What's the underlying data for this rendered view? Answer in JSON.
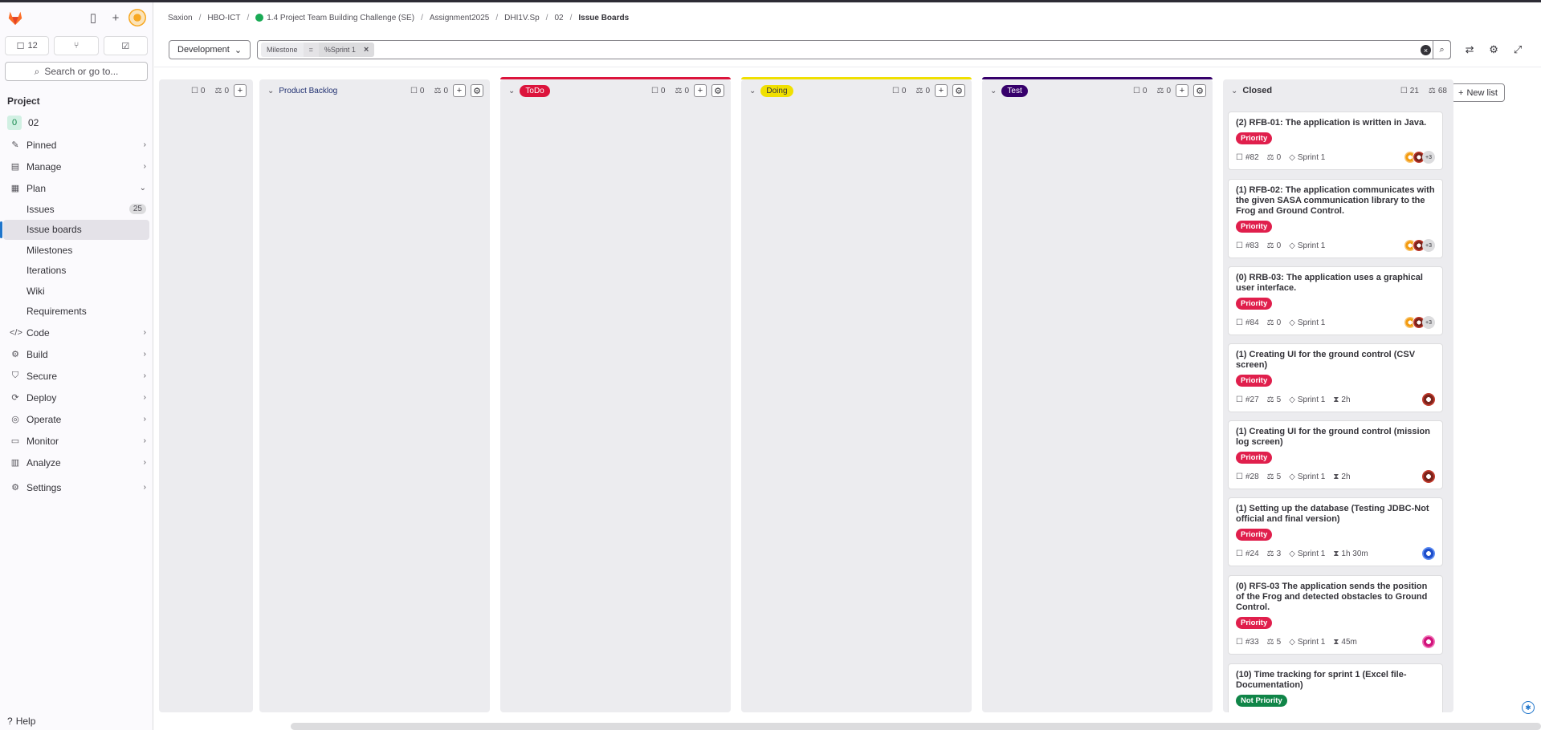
{
  "sidebar": {
    "counters": [
      {
        "icon": "issues-icon",
        "count": "12"
      },
      {
        "icon": "merge-request-icon",
        "count": ""
      },
      {
        "icon": "todo-icon",
        "count": ""
      }
    ],
    "search_label": "Search or go to...",
    "section_label": "Project",
    "project": {
      "badge": "0",
      "name": "02"
    },
    "nav": [
      {
        "icon": "pin-icon",
        "label": "Pinned"
      },
      {
        "icon": "manage-icon",
        "label": "Manage"
      },
      {
        "icon": "plan-icon",
        "label": "Plan"
      }
    ],
    "plan_items": [
      {
        "label": "Issues",
        "count": "25"
      },
      {
        "label": "Issue boards"
      },
      {
        "label": "Milestones"
      },
      {
        "label": "Iterations"
      },
      {
        "label": "Wiki"
      },
      {
        "label": "Requirements"
      }
    ],
    "nav_after": [
      {
        "icon": "code-icon",
        "label": "Code"
      },
      {
        "icon": "build-icon",
        "label": "Build"
      },
      {
        "icon": "shield-icon",
        "label": "Secure"
      },
      {
        "icon": "deploy-icon",
        "label": "Deploy"
      },
      {
        "icon": "operate-icon",
        "label": "Operate"
      },
      {
        "icon": "monitor-icon",
        "label": "Monitor"
      },
      {
        "icon": "analyze-icon",
        "label": "Analyze"
      },
      {
        "icon": "gear-icon",
        "label": "Settings"
      }
    ],
    "help_label": "Help"
  },
  "breadcrumb": [
    "Saxion",
    "HBO-ICT",
    "1.4 Project Team Building Challenge (SE)",
    "Assignment2025",
    "DHI1V.Sp",
    "02",
    "Issue Boards"
  ],
  "filterbar": {
    "board_dropdown": "Development",
    "token": {
      "field": "Milestone",
      "operator": "=",
      "value": "%Sprint 1"
    }
  },
  "new_list_label": "New list",
  "lists": [
    {
      "title": "",
      "issues": "0",
      "weight": "0"
    },
    {
      "title": "Product Backlog",
      "issues": "0",
      "weight": "0"
    },
    {
      "title": "ToDo",
      "issues": "0",
      "weight": "0",
      "color": "#dc143c",
      "text_color": "#ffffff"
    },
    {
      "title": "Doing",
      "issues": "0",
      "weight": "0",
      "color": "#f0e000",
      "text_color": "#333238"
    },
    {
      "title": "Test",
      "issues": "0",
      "weight": "0",
      "color": "#36006b",
      "text_color": "#ffffff"
    },
    {
      "title": "Closed",
      "issues": "21",
      "weight": "68"
    }
  ],
  "cards": [
    {
      "title": "(2) RFB-01: The application is written in Java.",
      "label": "Priority",
      "number": "#82",
      "weight": "0",
      "milestone": "Sprint 1",
      "time": "",
      "avatars": "+3"
    },
    {
      "title": "(1) RFB-02: The application communicates with the given SASA communication library to the Frog and Ground Control.",
      "label": "Priority",
      "number": "#83",
      "weight": "0",
      "milestone": "Sprint 1",
      "time": "",
      "avatars": "+3"
    },
    {
      "title": "(0) RRB-03: The application uses a graphical user interface.",
      "label": "Priority",
      "number": "#84",
      "weight": "0",
      "milestone": "Sprint 1",
      "time": "",
      "avatars": "+3"
    },
    {
      "title": "(1) Creating UI for the ground control (CSV screen)",
      "label": "Priority",
      "number": "#27",
      "weight": "5",
      "milestone": "Sprint 1",
      "time": "2h",
      "avatars": ""
    },
    {
      "title": "(1) Creating UI for the ground control (mission log screen)",
      "label": "Priority",
      "number": "#28",
      "weight": "5",
      "milestone": "Sprint 1",
      "time": "2h",
      "avatars": ""
    },
    {
      "title": "(1) Setting up the database (Testing JDBC-Not official and final version)",
      "label": "Priority",
      "number": "#24",
      "weight": "3",
      "milestone": "Sprint 1",
      "time": "1h 30m",
      "avatars": ""
    },
    {
      "title": "(0) RFS-03 The application sends the position of the Frog and detected obstacles to Ground Control.",
      "label": "Priority",
      "number": "#33",
      "weight": "5",
      "milestone": "Sprint 1",
      "time": "45m",
      "avatars": ""
    },
    {
      "title": "(10) Time tracking for sprint 1 (Excel file-Documentation)",
      "label": "Not Priority",
      "number": "",
      "weight": "",
      "milestone": "",
      "time": "",
      "avatars": ""
    }
  ]
}
